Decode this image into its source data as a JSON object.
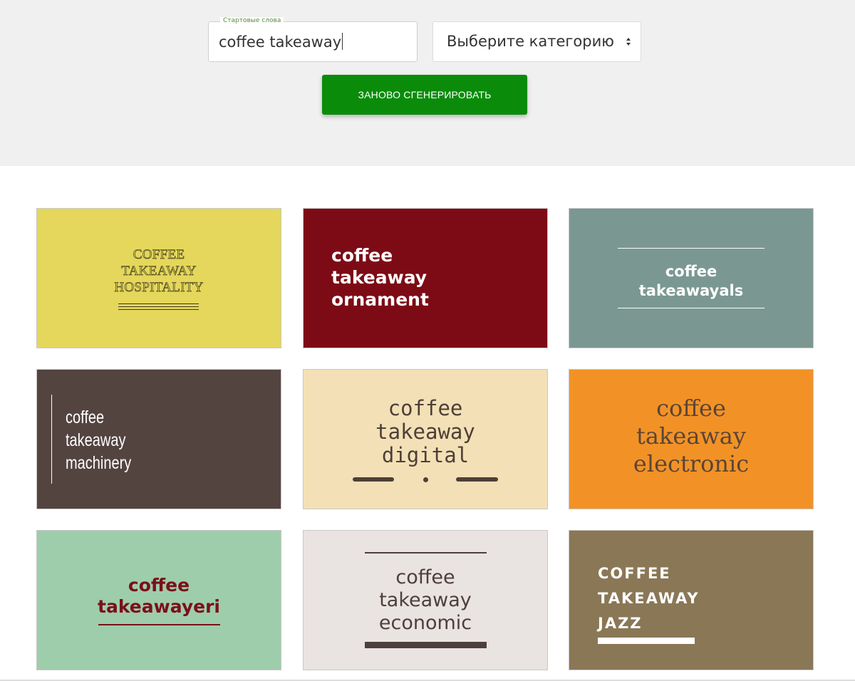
{
  "form": {
    "seed_label": "Стартовые слова",
    "seed_value": "coffee takeaway",
    "category_placeholder": "Выберите категорию",
    "regenerate_label": "ЗАНОВО СГЕНЕРИРОВАТЬ"
  },
  "icons": {
    "select": "sort-arrows-icon"
  },
  "colors": {
    "accent_button": "#0a8c0a"
  },
  "logos": [
    {
      "lines": [
        "COFFEE",
        "TAKEAWAY",
        "HOSPITALITY"
      ],
      "background": "#e4d75b",
      "text_color": "#5a5326"
    },
    {
      "lines": [
        "coffee",
        "takeaway",
        "ornament"
      ],
      "background": "#7d0b16",
      "text_color": "#ffffff"
    },
    {
      "lines": [
        "coffee",
        "takeawayals"
      ],
      "background": "#7a9891",
      "text_color": "#ffffff"
    },
    {
      "lines": [
        "coffee",
        "takeaway",
        "machinery"
      ],
      "background": "#544440",
      "text_color": "#ffffff"
    },
    {
      "lines": [
        "coffee",
        "takeaway",
        "digital"
      ],
      "background": "#f3e0b6",
      "text_color": "#4e3f38"
    },
    {
      "lines": [
        "coffee",
        "takeaway",
        "electronic"
      ],
      "background": "#f29226",
      "text_color": "#5a4536"
    },
    {
      "lines": [
        "coffee",
        "takeawayeri"
      ],
      "background": "#9ecdab",
      "text_color": "#7a1019"
    },
    {
      "lines": [
        "coffee",
        "takeaway",
        "economic"
      ],
      "background": "#e9e3e2",
      "text_color": "#4d3f3b"
    },
    {
      "lines": [
        "COFFEE",
        "TAKEAWAY",
        "JAZZ"
      ],
      "background": "#8a7756",
      "text_color": "#ffffff"
    }
  ]
}
